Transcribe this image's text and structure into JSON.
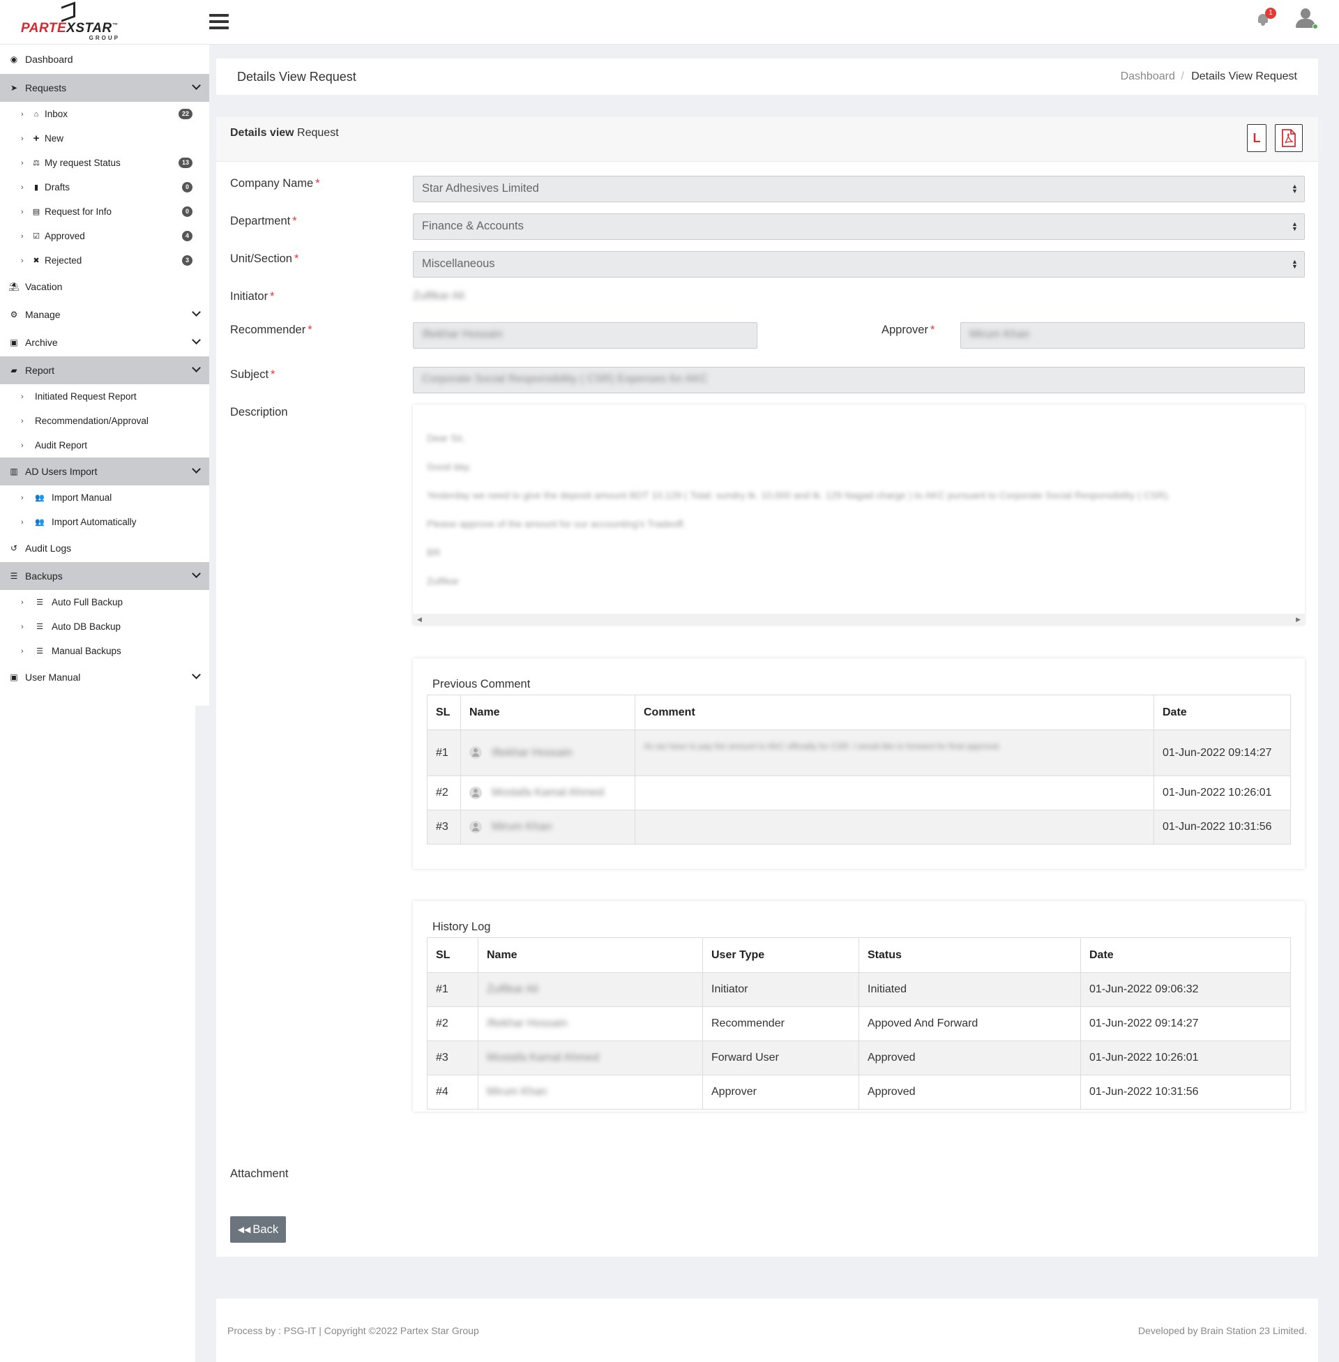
{
  "brand": {
    "part1": "PARTE",
    "part2": "X",
    "part3": "STAR",
    "tm": "™",
    "group": "GROUP"
  },
  "header": {
    "notification_count": "1"
  },
  "sidebar": {
    "dashboard": "Dashboard",
    "requests": "Requests",
    "requests_items": [
      {
        "label": "Inbox",
        "count": "22"
      },
      {
        "label": "New",
        "count": ""
      },
      {
        "label": "My request Status",
        "count": "13"
      },
      {
        "label": "Drafts",
        "count": "0"
      },
      {
        "label": "Request for Info",
        "count": "0"
      },
      {
        "label": "Approved",
        "count": "4"
      },
      {
        "label": "Rejected",
        "count": "3"
      }
    ],
    "vacation": "Vacation",
    "manage": "Manage",
    "archive": "Archive",
    "report": "Report",
    "report_items": [
      "Initiated Request Report",
      "Recommendation/Approval",
      "Audit Report"
    ],
    "ad_users_import": "AD Users Import",
    "ad_items": [
      "Import Manual",
      "Import Automatically"
    ],
    "audit_logs": "Audit Logs",
    "backups": "Backups",
    "backup_items": [
      "Auto Full Backup",
      "Auto DB Backup",
      "Manual Backups"
    ],
    "user_manual": "User Manual"
  },
  "page": {
    "title": "Details View Request",
    "breadcrumb_home": "Dashboard",
    "breadcrumb_sep": "/",
    "breadcrumb_current": "Details View Request"
  },
  "card": {
    "title_bold": "Details view",
    "title_rest": " Request",
    "l_button": "L"
  },
  "form": {
    "company_label": "Company Name",
    "company_value": "Star Adhesives Limited",
    "department_label": "Department",
    "department_value": "Finance & Accounts",
    "unit_label": "Unit/Section",
    "unit_value": "Miscellaneous",
    "initiator_label": "Initiator",
    "initiator_value": "Zulfikar Ali",
    "recommender_label": "Recommender",
    "recommender_value": "Iftekhar Hossain",
    "approver_label": "Approver",
    "approver_value": "Mirum Khan",
    "subject_label": "Subject",
    "subject_value": "Corporate Social Responsibility ( CSR) Expenses for AKC",
    "description_label": "Description",
    "description_lines": [
      "Dear Sir,",
      "Good day.",
      "Yesterday we need to give the deposit amount BDT 10,129 ( Total: sundry tk. 10,000 and tk. 129 Nagad charge ) to AKC pursuant to Corporate Social Responsibility ( CSR).",
      "Please approve of the amount for our accounting's Tradeoff.",
      "BR",
      "Zulfikar"
    ],
    "attachment_label": "Attachment",
    "back_button": "Back"
  },
  "previous_comment": {
    "title": "Previous Comment",
    "columns": [
      "SL",
      "Name",
      "Comment",
      "Date"
    ],
    "rows": [
      {
        "sl": "#1",
        "name": "Iftekhar Hossain",
        "comment": "As we have to pay the amount to AKC officially for CSR. I would like to forward for final approval.",
        "date": "01-Jun-2022 09:14:27"
      },
      {
        "sl": "#2",
        "name": "Mostafa Kamal Ahmed",
        "comment": "",
        "date": "01-Jun-2022 10:26:01"
      },
      {
        "sl": "#3",
        "name": "Mirum Khan",
        "comment": "",
        "date": "01-Jun-2022 10:31:56"
      }
    ]
  },
  "history_log": {
    "title": "History Log",
    "columns": [
      "SL",
      "Name",
      "User Type",
      "Status",
      "Date"
    ],
    "rows": [
      {
        "sl": "#1",
        "name": "Zulfikar Ali",
        "user_type": "Initiator",
        "status": "Initiated",
        "date": "01-Jun-2022 09:06:32"
      },
      {
        "sl": "#2",
        "name": "Iftekhar Hossain",
        "user_type": "Recommender",
        "status": "Appoved And Forward",
        "date": "01-Jun-2022 09:14:27"
      },
      {
        "sl": "#3",
        "name": "Mostafa Kamal Ahmed",
        "user_type": "Forward User",
        "status": "Approved",
        "date": "01-Jun-2022 10:26:01"
      },
      {
        "sl": "#4",
        "name": "Mirum Khan",
        "user_type": "Approver",
        "status": "Approved",
        "date": "01-Jun-2022 10:31:56"
      }
    ]
  },
  "footer": {
    "left": "Process by : PSG-IT | Copyright ©2022 Partex Star Group",
    "right": "Developed by Brain Station 23 Limited."
  },
  "colors": {
    "accent_red": "#e53935",
    "sidebar_active": "#c9cbce",
    "back_button": "#6c757d"
  }
}
